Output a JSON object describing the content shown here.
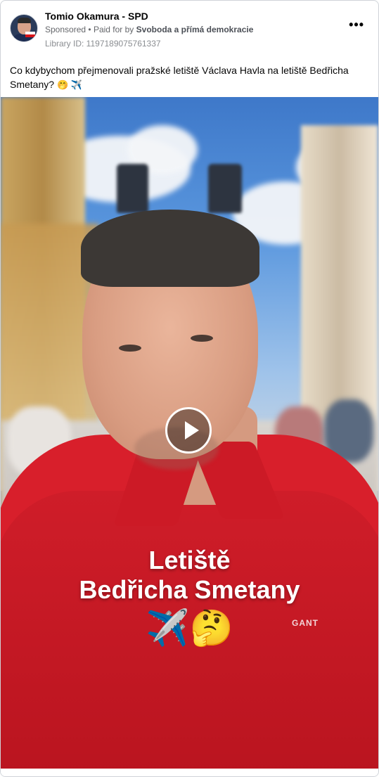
{
  "post": {
    "page_name": "Tomio Okamura - SPD",
    "sponsored_label": "Sponsored",
    "paid_for_prefix": "Paid for by",
    "payer": "Svoboda a přímá demokracie",
    "library_id": "Library ID: 1197189075761337",
    "more_icon": "•••",
    "caption_text": "Co kdybychom přejmenovali pražské letiště Václava Havla na letiště Bedřicha Smetany?",
    "caption_emojis": "🤭 ✈️"
  },
  "video": {
    "overlay_line1": "Letiště",
    "overlay_line2": "Bedřicha Smetany",
    "overlay_emojis": "✈️🤔",
    "shirt_logo": "GANT",
    "play_icon": "play-icon"
  },
  "colors": {
    "shirt": "#d81f2b",
    "sky": "#4f8bd5",
    "text_primary": "#050505",
    "text_secondary": "#65676b"
  }
}
